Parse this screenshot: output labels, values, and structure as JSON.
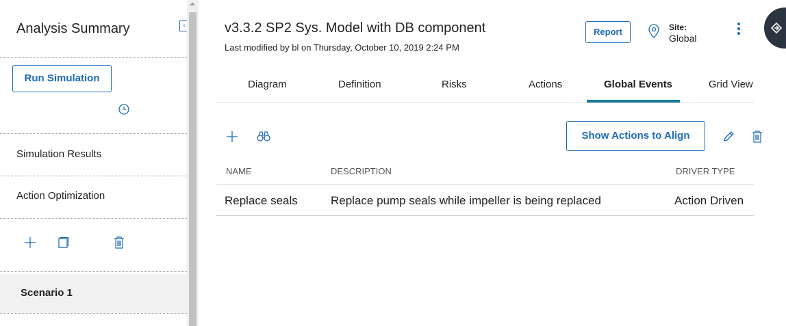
{
  "sidebar": {
    "title": "Analysis Summary",
    "run_button": "Run Simulation",
    "items": [
      "Simulation Results",
      "Action Optimization"
    ],
    "scenario": "Scenario 1"
  },
  "header": {
    "title": "v3.3.2 SP2 Sys. Model with DB component",
    "subtitle": "Last modified by bl on Thursday, October 10, 2019 2:24 PM",
    "report_button": "Report",
    "site_label": "Site:",
    "site_value": "Global"
  },
  "tabs": [
    {
      "label": "Diagram",
      "active": false
    },
    {
      "label": "Definition",
      "active": false
    },
    {
      "label": "Risks",
      "active": false
    },
    {
      "label": "Actions",
      "active": false
    },
    {
      "label": "Global Events",
      "active": true
    },
    {
      "label": "Grid View",
      "active": false
    }
  ],
  "toolbar": {
    "align_button": "Show Actions to Align"
  },
  "table": {
    "columns": [
      "NAME",
      "DESCRIPTION",
      "DRIVER TYPE"
    ],
    "rows": [
      [
        "Replace seals",
        "Replace pump seals while impeller is being replaced",
        "Action Driven"
      ]
    ]
  },
  "colors": {
    "accent": "#1e6bb8",
    "tab_active": "#1a7a98",
    "fab": "#2b3440"
  }
}
